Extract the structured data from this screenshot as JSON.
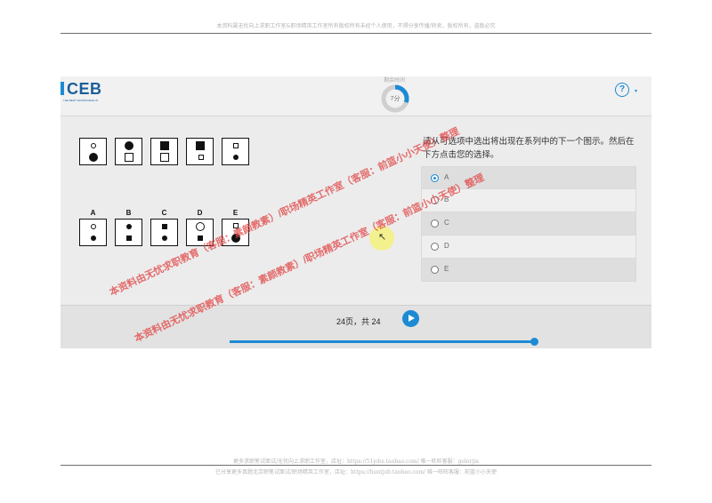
{
  "doc": {
    "header": "本资料属无忧向上求职工作室&职场精英工作室所有版权所有未经个人使用，不得分享传播/转卖，版权所有，盗版必究",
    "footer_line1": "更多求职笔试面试/无忧向上求职工作室，店址：https://51jobs.taobao.com/ 唯一旺旺客服：gelerjin",
    "footer_line2": "已分享更多真题北京职笔试面试/职场精英工作室，店址：https://huntjob.taobao.com/ 唯一旺旺客服：前篮小小天使"
  },
  "app": {
    "logo_text": "CEB",
    "logo_subtitle": "THE BEST WORKFORCE IN",
    "timer_label": "剩余时间",
    "timer_value": "7分",
    "timer_fraction": 0.3,
    "help_icon": "?",
    "help_caret": "▾"
  },
  "question": {
    "prompt": "请从可选项中选出将出现在系列中的下一个图示。然后在下方点击您的选择。",
    "option_letters": [
      "A",
      "B",
      "C",
      "D",
      "E"
    ],
    "options": [
      {
        "label": "A",
        "selected": true
      },
      {
        "label": "B",
        "selected": false
      },
      {
        "label": "C",
        "selected": false
      },
      {
        "label": "D",
        "selected": false
      },
      {
        "label": "E",
        "selected": false
      }
    ]
  },
  "footer": {
    "page_indicator": "24页，共 24",
    "progress_fraction": 1.0
  },
  "watermark": {
    "text1": "本资料由无忧求职教育（客服：素颜教素）/职场精英工作室（客服：前篮小小天使）整理",
    "text2": "本资料由无忧求职教育（客服：素颜教素）/职场精英工作室（客服：前篮小小天使）整理"
  },
  "colors": {
    "accent": "#1d8ad4",
    "watermark": "#e24646",
    "brand": "#1a5e9a"
  }
}
